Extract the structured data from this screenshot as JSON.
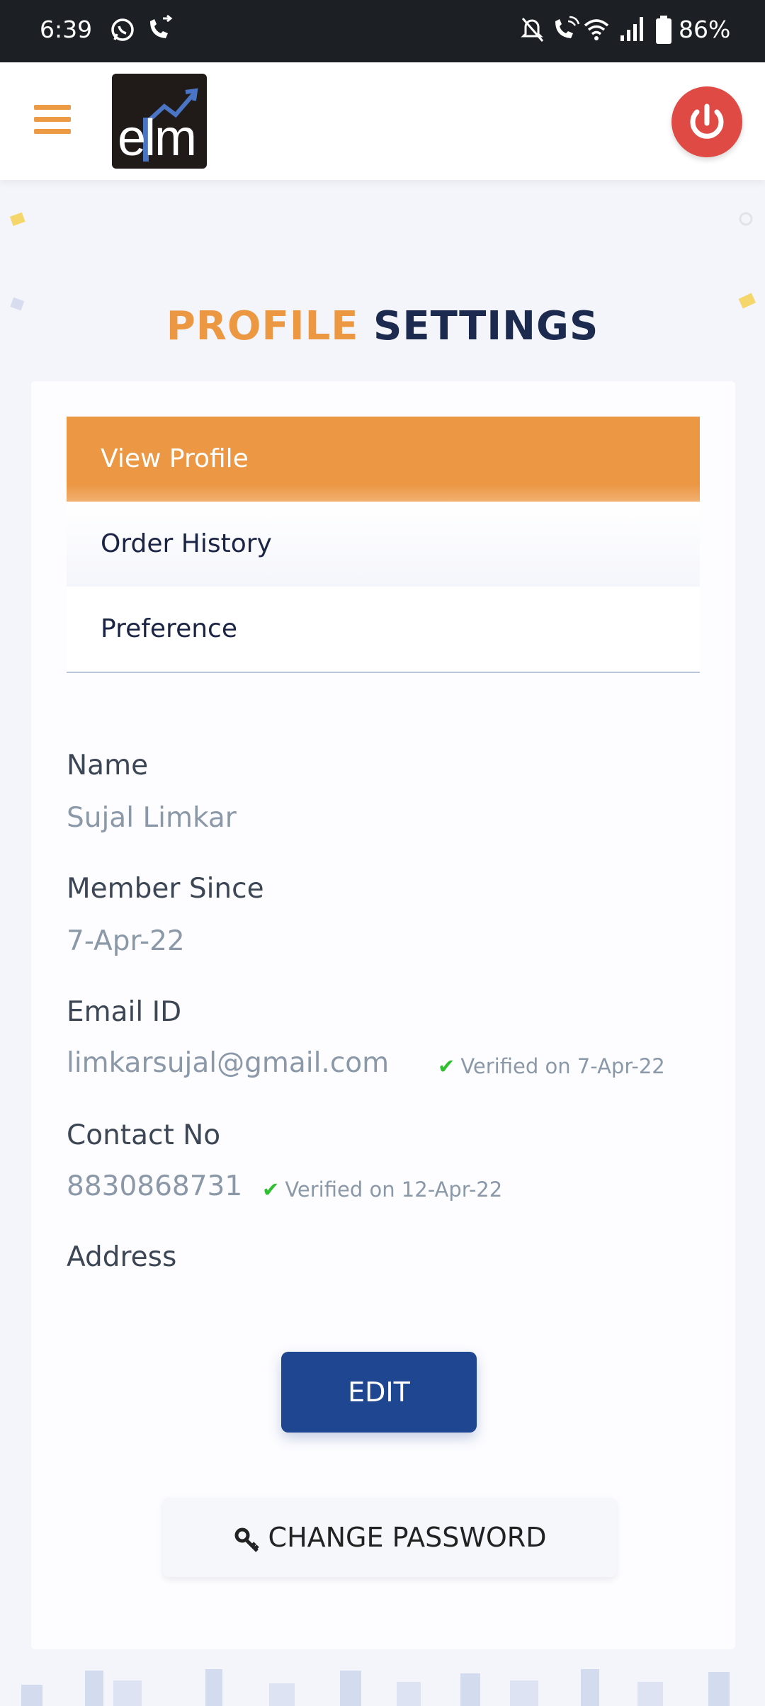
{
  "status_bar": {
    "time": "6:39",
    "battery": "86%",
    "icons": [
      "whatsapp-icon",
      "call-forward-icon",
      "mute-icon",
      "wifi-call-icon",
      "wifi-icon",
      "signal-icon",
      "battery-icon"
    ]
  },
  "header": {
    "logo_text": "elm",
    "menu_icon": "hamburger-icon",
    "power_icon": "power-icon"
  },
  "page": {
    "title_part1": "PROFILE",
    "title_part2": "SETTINGS"
  },
  "tabs": [
    {
      "label": "View Profile",
      "active": true
    },
    {
      "label": "Order History",
      "active": false
    },
    {
      "label": "Preference",
      "active": false
    }
  ],
  "profile": {
    "name_label": "Name",
    "name_value": "Sujal Limkar",
    "member_label": "Member Since",
    "member_value": "7-Apr-22",
    "email_label": "Email ID",
    "email_value": "limkarsujal@gmail.com",
    "email_verified": "Verified on 7-Apr-22",
    "contact_label": "Contact No",
    "contact_value": "8830868731",
    "contact_verified": "Verified on 12-Apr-22",
    "address_label": "Address",
    "address_value": ""
  },
  "actions": {
    "edit_label": "EDIT",
    "change_password_label": "CHANGE PASSWORD"
  },
  "colors": {
    "accent_orange": "#eb9744",
    "navy": "#1b2a4e",
    "button_blue": "#1f4690",
    "power_red": "#e04a45"
  }
}
